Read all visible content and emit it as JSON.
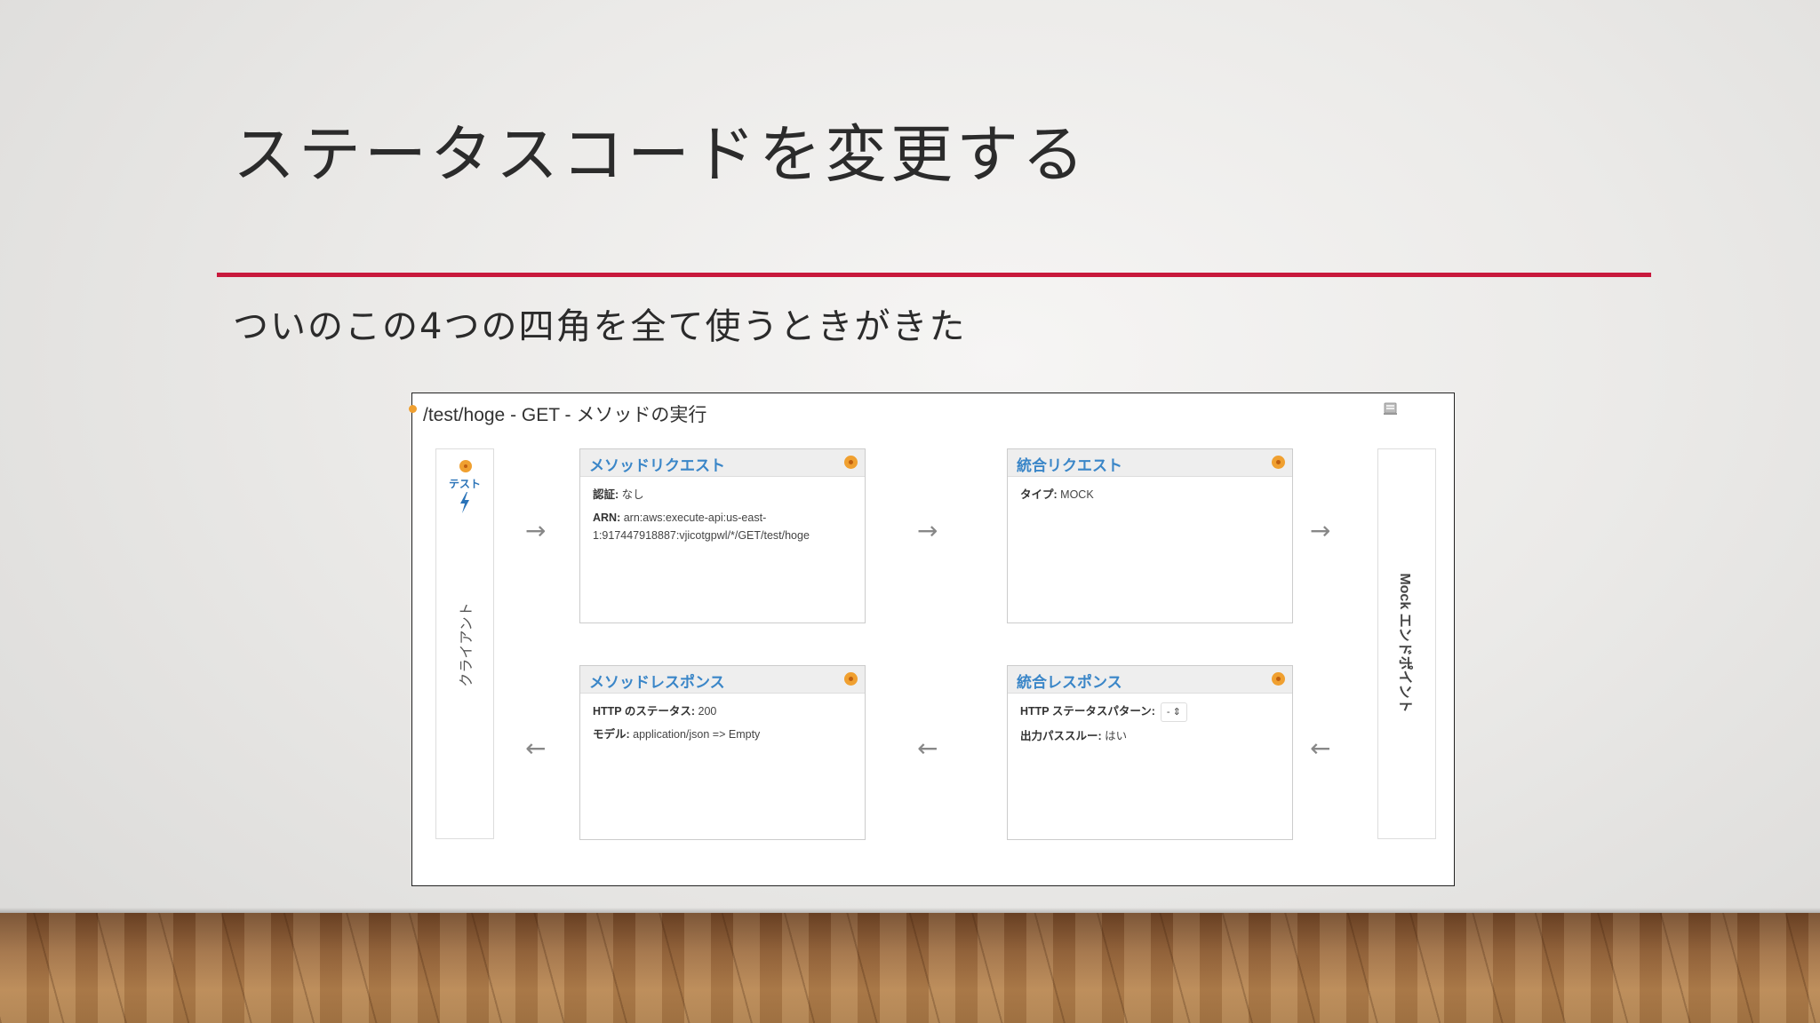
{
  "slide": {
    "title": "ステータスコードを変更する",
    "subtitle": "ついのこの4つの四角を全て使うときがきた",
    "accent_color": "#c8193c"
  },
  "panel": {
    "header_path": "/test/hoge - GET - メソッドの実行",
    "client": {
      "test_label": "テスト",
      "label": "クライアント"
    },
    "endpoint": {
      "label": "Mock エンドポイント"
    },
    "method_request": {
      "title": "メソッドリクエスト",
      "auth_key": "認証:",
      "auth_value": "なし",
      "arn_key": "ARN:",
      "arn_value_1": "arn:aws:execute-api:us-east-",
      "arn_value_2": "1:917447918887:vjicotgpwl/*/GET/test/hoge"
    },
    "integration_request": {
      "title": "統合リクエスト",
      "type_key": "タイプ:",
      "type_value": "MOCK"
    },
    "method_response": {
      "title": "メソッドレスポンス",
      "status_key": "HTTP のステータス:",
      "status_value": "200",
      "model_key": "モデル:",
      "model_value": "application/json => Empty"
    },
    "integration_response": {
      "title": "統合レスポンス",
      "pattern_key": "HTTP ステータスパターン:",
      "pattern_value": "- ⇕",
      "passthrough_key": "出力パススルー:",
      "passthrough_value": "はい"
    },
    "arrows": {
      "right": "→",
      "left": "←"
    }
  }
}
